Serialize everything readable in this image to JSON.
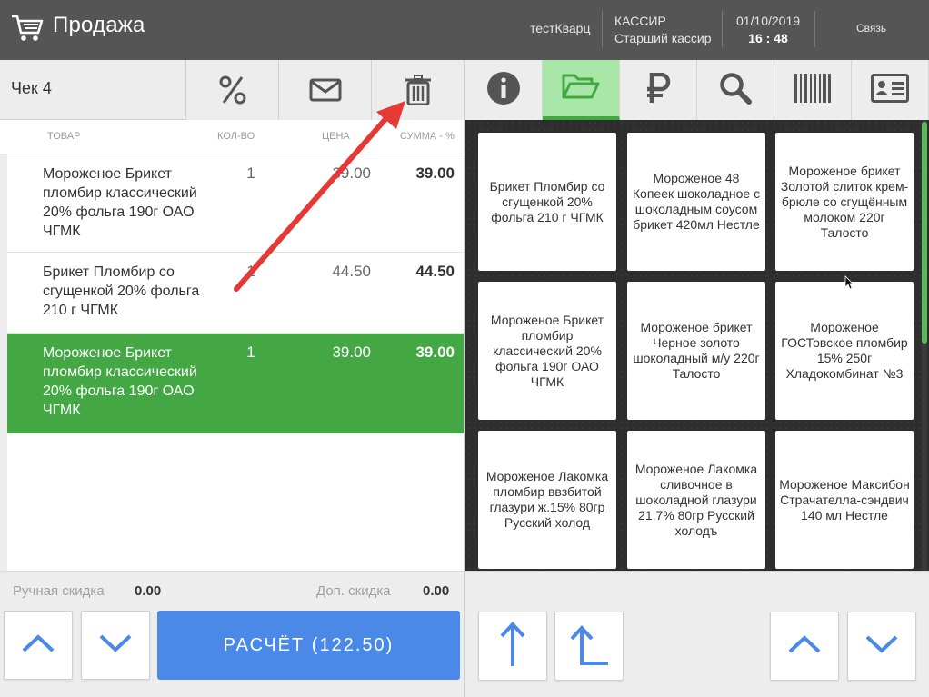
{
  "header": {
    "title": "Продажа",
    "user": "тестКварц",
    "role_label": "КАССИР",
    "role_name": "Старший кассир",
    "date": "01/10/2019",
    "time": "16 : 48",
    "link": "Связь",
    "cart_icon": "cart-icon"
  },
  "check": {
    "label": "Чек 4",
    "buttons": [
      {
        "name": "discount",
        "icon": "percent-icon"
      },
      {
        "name": "email",
        "icon": "envelope-icon"
      },
      {
        "name": "delete",
        "icon": "trash-icon"
      }
    ]
  },
  "table": {
    "columns": [
      "ТОВАР",
      "КОЛ-ВО",
      "ЦЕНА",
      "СУММА - %"
    ],
    "rows": [
      {
        "name": "Мороженое Брикет пломбир классический 20% фольга 190г ОАО ЧГМК",
        "qty": "1",
        "price": "39.00",
        "sum": "39.00",
        "selected": false
      },
      {
        "name": "Брикет Пломбир со сгущенкой 20% фольга 210 г ЧГМК",
        "qty": "1",
        "price": "44.50",
        "sum": "44.50",
        "selected": false
      },
      {
        "name": "Мороженое Брикет пломбир классический 20% фольга 190г ОАО ЧГМК",
        "qty": "1",
        "price": "39.00",
        "sum": "39.00",
        "selected": true
      }
    ]
  },
  "discounts": {
    "manual_label": "Ручная скидка",
    "manual_value": "0.00",
    "extra_label": "Доп. скидка",
    "extra_value": "0.00"
  },
  "pay_button": "РАСЧЁТ (122.50)",
  "right_tabs": [
    {
      "icon": "info-icon",
      "active": false
    },
    {
      "icon": "folder-open-icon",
      "active": true
    },
    {
      "icon": "ruble-icon",
      "active": false
    },
    {
      "icon": "search-icon",
      "active": false
    },
    {
      "icon": "barcode-icon",
      "active": false
    },
    {
      "icon": "id-card-icon",
      "active": false
    }
  ],
  "products": [
    "Брикет Пломбир со сгущенкой 20% фольга 210 г ЧГМК",
    "Мороженое 48 Копеек шоколадное с шоколадным соусом брикет 420мл Нестле",
    "Мороженое брикет Золотой слиток крем-брюле со сгущённым молоком 220г Талосто",
    "Мороженое Брикет пломбир классический 20% фольга 190г ОАО ЧГМК",
    "Мороженое брикет Черное золото шоколадный м/у 220г Талосто",
    "Мороженое ГОСТовское пломбир 15% 250г Хладокомбинат №3",
    "Мороженое Лакомка пломбир ввзбитой глазури ж.15% 80гр Русский холод",
    "Мороженое Лакомка сливочное в шоколадной глазури 21,7% 80гр Русский холодъ",
    "Мороженое Максибон Страчателла-сэндвич 140 мл Нестле"
  ],
  "colors": {
    "header_bg": "#555555",
    "selected_row": "#43a843",
    "active_tab": "#a9e7a9",
    "pay_button": "#4a89e8",
    "arrow_blue": "#4a89e8",
    "annotation_arrow": "#e53935"
  }
}
